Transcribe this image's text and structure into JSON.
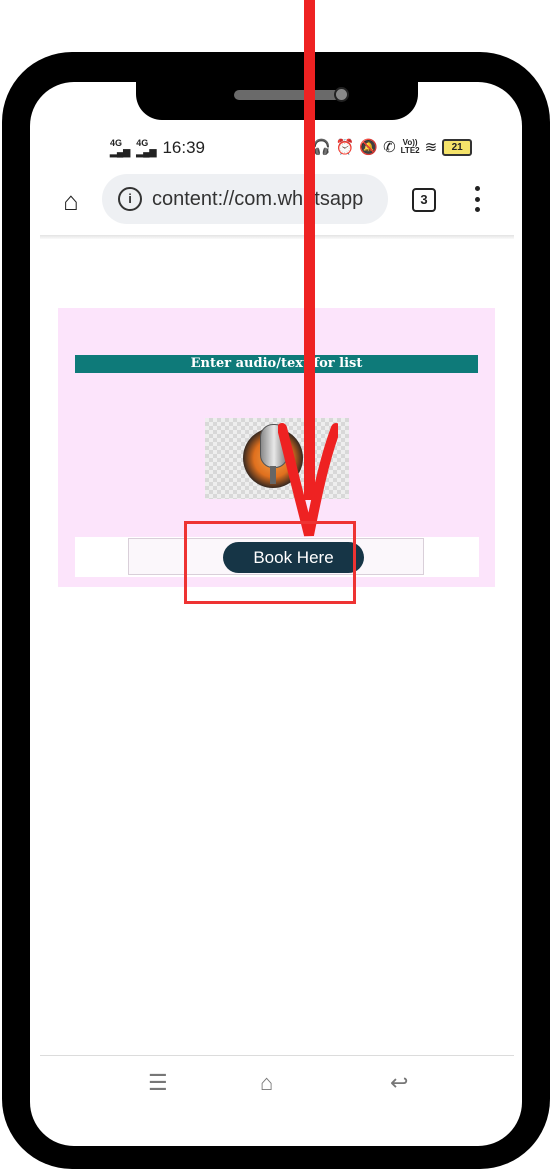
{
  "status_bar": {
    "signal_left": "4G",
    "signal_right": "4G",
    "time": "16:39",
    "volte": "Vo))",
    "lte": "LTE2",
    "battery": "21"
  },
  "browser": {
    "url": "content://com.whatsapp",
    "tab_count": "3"
  },
  "page": {
    "header": "Enter audio/text for list",
    "book_button": "Book Here"
  },
  "icons": [
    "home-icon",
    "info-icon",
    "tabs-icon",
    "menu-icon",
    "microphone-icon",
    "recents-icon",
    "nav-home-icon",
    "back-icon"
  ],
  "colors": {
    "header_bg": "#0e7a79",
    "panel_bg": "#fce4fb",
    "button_bg": "#163546",
    "annotation": "#ee2222"
  }
}
